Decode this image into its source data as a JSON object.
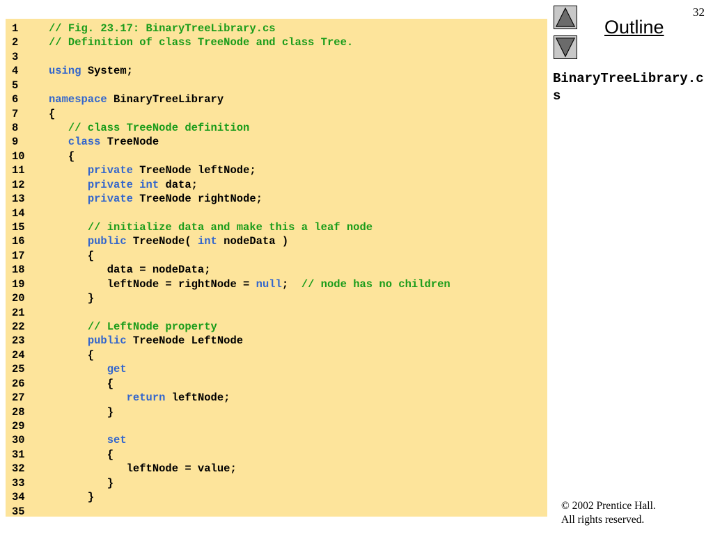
{
  "slide": {
    "number": "32",
    "outline_label": "Outline",
    "file_title": "BinaryTreeLibrary.cs",
    "copyright_line1": "© 2002 Prentice Hall.",
    "copyright_line2": "All rights reserved."
  },
  "nav": {
    "up_icon": "triangle-up-icon",
    "down_icon": "triangle-down-icon"
  },
  "colors": {
    "panel_background": "#fde49b",
    "comment": "#1a9c1a",
    "keyword": "#3366cc",
    "text": "#000000"
  },
  "code_lines": [
    {
      "num": "1",
      "tokens": [
        [
          "c",
          "// Fig. 23.17: BinaryTreeLibrary.cs"
        ]
      ]
    },
    {
      "num": "2",
      "tokens": [
        [
          "c",
          "// Definition of class TreeNode and class Tree."
        ]
      ]
    },
    {
      "num": "3",
      "tokens": []
    },
    {
      "num": "4",
      "tokens": [
        [
          "k",
          "using"
        ],
        [
          "t",
          " System;"
        ]
      ]
    },
    {
      "num": "5",
      "tokens": []
    },
    {
      "num": "6",
      "tokens": [
        [
          "k",
          "namespace"
        ],
        [
          "t",
          " BinaryTreeLibrary"
        ]
      ]
    },
    {
      "num": "7",
      "tokens": [
        [
          "t",
          "{"
        ]
      ]
    },
    {
      "num": "8",
      "tokens": [
        [
          "t",
          "   "
        ],
        [
          "c",
          "// class TreeNode definition"
        ]
      ]
    },
    {
      "num": "9",
      "tokens": [
        [
          "t",
          "   "
        ],
        [
          "k",
          "class"
        ],
        [
          "t",
          " TreeNode"
        ]
      ]
    },
    {
      "num": "10",
      "tokens": [
        [
          "t",
          "   {"
        ]
      ]
    },
    {
      "num": "11",
      "tokens": [
        [
          "t",
          "      "
        ],
        [
          "k",
          "private"
        ],
        [
          "t",
          " TreeNode leftNode;"
        ]
      ]
    },
    {
      "num": "12",
      "tokens": [
        [
          "t",
          "      "
        ],
        [
          "k",
          "private"
        ],
        [
          "t",
          " "
        ],
        [
          "k",
          "int"
        ],
        [
          "t",
          " data;"
        ]
      ]
    },
    {
      "num": "13",
      "tokens": [
        [
          "t",
          "      "
        ],
        [
          "k",
          "private"
        ],
        [
          "t",
          " TreeNode rightNode;"
        ]
      ]
    },
    {
      "num": "14",
      "tokens": []
    },
    {
      "num": "15",
      "tokens": [
        [
          "t",
          "      "
        ],
        [
          "c",
          "// initialize data and make this a leaf node"
        ]
      ]
    },
    {
      "num": "16",
      "tokens": [
        [
          "t",
          "      "
        ],
        [
          "k",
          "public"
        ],
        [
          "t",
          " TreeNode( "
        ],
        [
          "k",
          "int"
        ],
        [
          "t",
          " nodeData )"
        ]
      ]
    },
    {
      "num": "17",
      "tokens": [
        [
          "t",
          "      {"
        ]
      ]
    },
    {
      "num": "18",
      "tokens": [
        [
          "t",
          "         data = nodeData;"
        ]
      ]
    },
    {
      "num": "19",
      "tokens": [
        [
          "t",
          "         leftNode = rightNode = "
        ],
        [
          "k",
          "null"
        ],
        [
          "t",
          ";  "
        ],
        [
          "c",
          "// node has no children"
        ]
      ]
    },
    {
      "num": "20",
      "tokens": [
        [
          "t",
          "      }"
        ]
      ]
    },
    {
      "num": "21",
      "tokens": []
    },
    {
      "num": "22",
      "tokens": [
        [
          "t",
          "      "
        ],
        [
          "c",
          "// LeftNode property"
        ]
      ]
    },
    {
      "num": "23",
      "tokens": [
        [
          "t",
          "      "
        ],
        [
          "k",
          "public"
        ],
        [
          "t",
          " TreeNode LeftNode"
        ]
      ]
    },
    {
      "num": "24",
      "tokens": [
        [
          "t",
          "      {"
        ]
      ]
    },
    {
      "num": "25",
      "tokens": [
        [
          "t",
          "         "
        ],
        [
          "k",
          "get"
        ]
      ]
    },
    {
      "num": "26",
      "tokens": [
        [
          "t",
          "         {"
        ]
      ]
    },
    {
      "num": "27",
      "tokens": [
        [
          "t",
          "            "
        ],
        [
          "k",
          "return"
        ],
        [
          "t",
          " leftNode;"
        ]
      ]
    },
    {
      "num": "28",
      "tokens": [
        [
          "t",
          "         }"
        ]
      ]
    },
    {
      "num": "29",
      "tokens": []
    },
    {
      "num": "30",
      "tokens": [
        [
          "t",
          "         "
        ],
        [
          "k",
          "set"
        ]
      ]
    },
    {
      "num": "31",
      "tokens": [
        [
          "t",
          "         {"
        ]
      ]
    },
    {
      "num": "32",
      "tokens": [
        [
          "t",
          "            leftNode = value;"
        ]
      ]
    },
    {
      "num": "33",
      "tokens": [
        [
          "t",
          "         }"
        ]
      ]
    },
    {
      "num": "34",
      "tokens": [
        [
          "t",
          "      }"
        ]
      ]
    },
    {
      "num": "35",
      "tokens": []
    }
  ]
}
